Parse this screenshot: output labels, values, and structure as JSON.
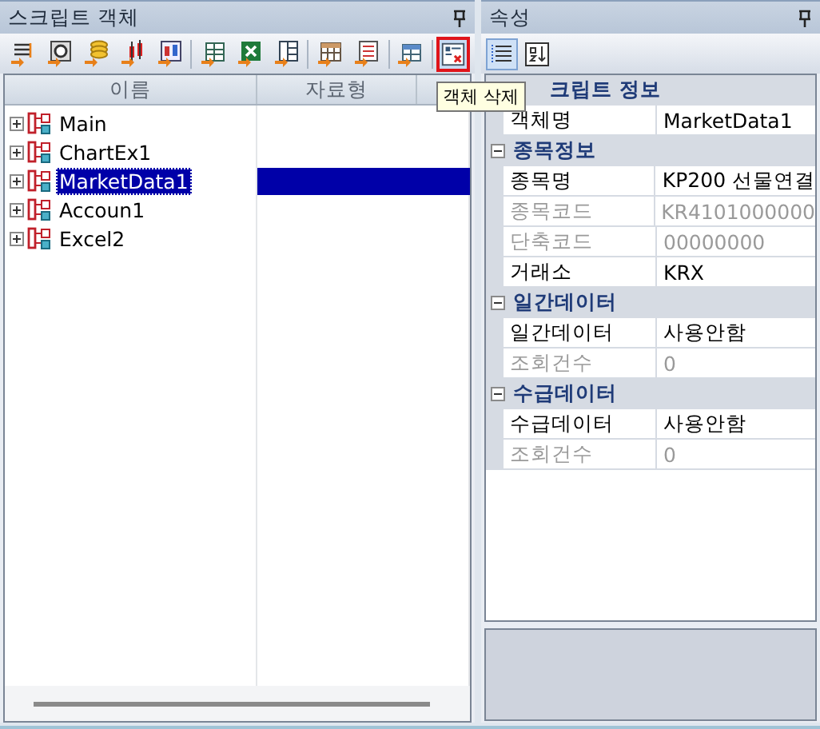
{
  "left_panel": {
    "title": "스크립트 객체",
    "toolbar": {
      "groups": [
        [
          {
            "kind": "lines",
            "hovered": false
          },
          {
            "kind": "search",
            "hovered": false
          },
          {
            "kind": "coins",
            "hovered": false
          },
          {
            "kind": "candles",
            "hovered": false
          },
          {
            "kind": "chart",
            "hovered": false
          }
        ],
        [
          {
            "kind": "table",
            "hovered": false
          },
          {
            "kind": "excel",
            "hovered": false
          },
          {
            "kind": "columns",
            "hovered": false
          }
        ],
        [
          {
            "kind": "calendar",
            "hovered": false
          },
          {
            "kind": "list",
            "hovered": false
          }
        ],
        [
          {
            "kind": "grid",
            "hovered": false
          }
        ],
        [
          {
            "kind": "delete",
            "hovered": true
          }
        ]
      ]
    },
    "tooltip": "객체 삭제",
    "columns": [
      "이름",
      "자료형"
    ],
    "items": [
      {
        "label": "Main",
        "selected": false,
        "expanded": false
      },
      {
        "label": "ChartEx1",
        "selected": false,
        "expanded": false
      },
      {
        "label": "MarketData1",
        "selected": true,
        "expanded": false
      },
      {
        "label": "Accoun1",
        "selected": false,
        "expanded": false
      },
      {
        "label": "Excel2",
        "selected": false,
        "expanded": false
      }
    ]
  },
  "right_panel": {
    "title": "속성",
    "view_buttons": [
      {
        "kind": "categorized",
        "selected": true
      },
      {
        "kind": "alphabetical",
        "selected": false
      }
    ],
    "categories": [
      {
        "title": "크립트 정보",
        "rows": [
          {
            "name": "객체명",
            "value": "MarketData1",
            "disabled": false
          }
        ]
      },
      {
        "title": "종목정보",
        "expanded": true,
        "rows": [
          {
            "name": "종목명",
            "value": "KP200 선물연결",
            "disabled": false
          },
          {
            "name": "종목코드",
            "value": "KR4101000000",
            "disabled": true
          },
          {
            "name": "단축코드",
            "value": "00000000",
            "disabled": true
          },
          {
            "name": "거래소",
            "value": "KRX",
            "disabled": false
          }
        ]
      },
      {
        "title": "일간데이터",
        "expanded": true,
        "rows": [
          {
            "name": "일간데이터",
            "value": "사용안함",
            "disabled": false
          },
          {
            "name": "조회건수",
            "value": "0",
            "disabled": true
          }
        ]
      },
      {
        "title": "수급데이터",
        "expanded": true,
        "rows": [
          {
            "name": "수급데이터",
            "value": "사용안함",
            "disabled": false
          },
          {
            "name": "조회건수",
            "value": "0",
            "disabled": true
          }
        ]
      }
    ]
  }
}
